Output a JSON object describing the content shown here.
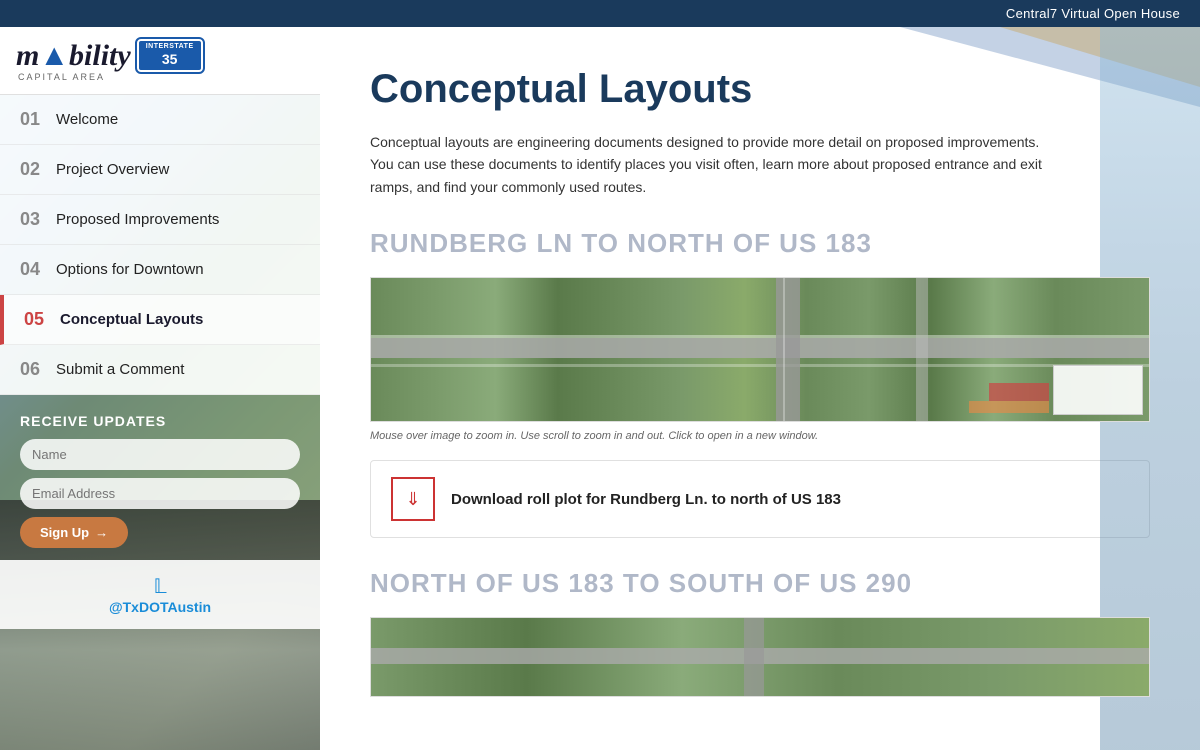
{
  "topbar": {
    "title": "Central7 Virtual Open House"
  },
  "logo": {
    "text": "m",
    "brand": "bility",
    "state_icon": "TX",
    "subtitle": "CAPITAL AREA",
    "i35_interstate": "INTERSTATE",
    "i35_number": "35"
  },
  "nav": {
    "items": [
      {
        "num": "01",
        "label": "Welcome",
        "active": false
      },
      {
        "num": "02",
        "label": "Project Overview",
        "active": false
      },
      {
        "num": "03",
        "label": "Proposed Improvements",
        "active": false
      },
      {
        "num": "04",
        "label": "Options for Downtown",
        "active": false
      },
      {
        "num": "05",
        "label": "Conceptual Layouts",
        "active": true
      },
      {
        "num": "06",
        "label": "Submit a Comment",
        "active": false
      }
    ]
  },
  "updates": {
    "title": "RECEIVE UPDATES",
    "name_placeholder": "Name",
    "email_placeholder": "Email Address",
    "button_label": "Sign Up",
    "button_arrow": "→"
  },
  "twitter": {
    "handle": "@TxDOTAustin"
  },
  "main": {
    "title": "Conceptual Layouts",
    "description": "Conceptual layouts are engineering documents designed to provide more detail on proposed improvements. You can use these documents to identify places you visit often, learn more about proposed entrance and exit ramps, and find your commonly used routes.",
    "sections": [
      {
        "heading": "RUNDBERG LN TO NORTH OF US 183",
        "map_caption": "Mouse over image to zoom in. Use scroll to zoom in and out. Click to open in a new window.",
        "download_label": "Download roll plot for Rundberg Ln. to north of US 183"
      },
      {
        "heading": "NORTH OF US 183 TO SOUTH OF US 290"
      }
    ]
  }
}
